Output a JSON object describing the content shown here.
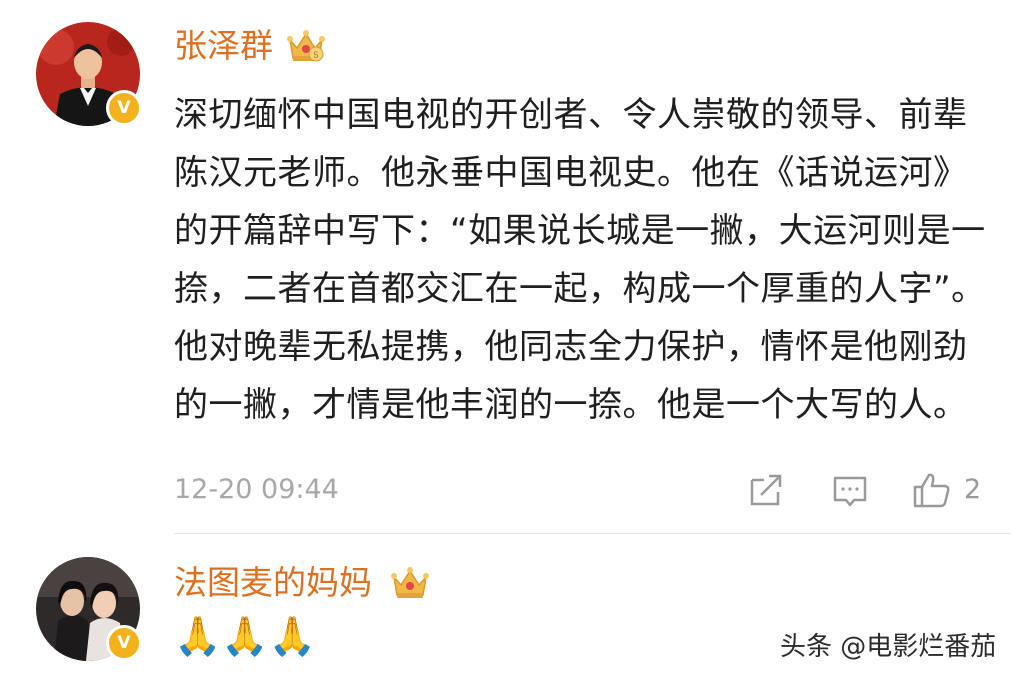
{
  "comments": [
    {
      "username": "张泽群",
      "badge_icon": "crown-icon",
      "verified_badge": "V",
      "text": "深切缅怀中国电视的开创者、令人崇敬的领导、前辈陈汉元老师。他永垂中国电视史。他在《话说运河》的开篇辞中写下：“如果说长城是一撇，大运河则是一捺，二者在首都交汇在一起，构成一个厚重的人字”。他对晚辈无私提携，他同志全力保护，情怀是他刚劲的一撇，才情是他丰润的一捺。他是一个大写的人。",
      "timestamp": "12-20 09:44",
      "actions": {
        "share_icon": "share-icon",
        "comment_icon": "comment-icon",
        "like_icon": "thumbs-up-icon",
        "like_count": "2"
      }
    },
    {
      "username": "法图麦的妈妈",
      "badge_icon": "crown-icon",
      "verified_badge": "V",
      "text": "🙏🙏🙏"
    }
  ],
  "watermark": "头条 @电影烂番茄",
  "colors": {
    "username": "#e0701f",
    "text": "#1f1f1f",
    "meta": "#a8a8a8",
    "verified": "#f3b21b"
  }
}
